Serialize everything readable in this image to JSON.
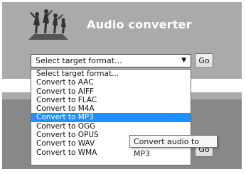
{
  "app": {
    "title": "Audio converter"
  },
  "form": {
    "selected_value": "Select target format...",
    "go_label": "Go",
    "options": [
      "Select target format...",
      "Convert to AAC",
      "Convert to AIFF",
      "Convert to FLAC",
      "Convert to M4A",
      "Convert to MP3",
      "Convert to OGG",
      "Convert to OPUS",
      "Convert to WAV",
      "Convert to WMA"
    ],
    "highlighted_option": "Convert to MP3"
  },
  "tooltip": {
    "text": "Convert audio to MP3"
  },
  "colors": {
    "panel": "#aaaaaa",
    "highlight": "#1e90ff"
  }
}
